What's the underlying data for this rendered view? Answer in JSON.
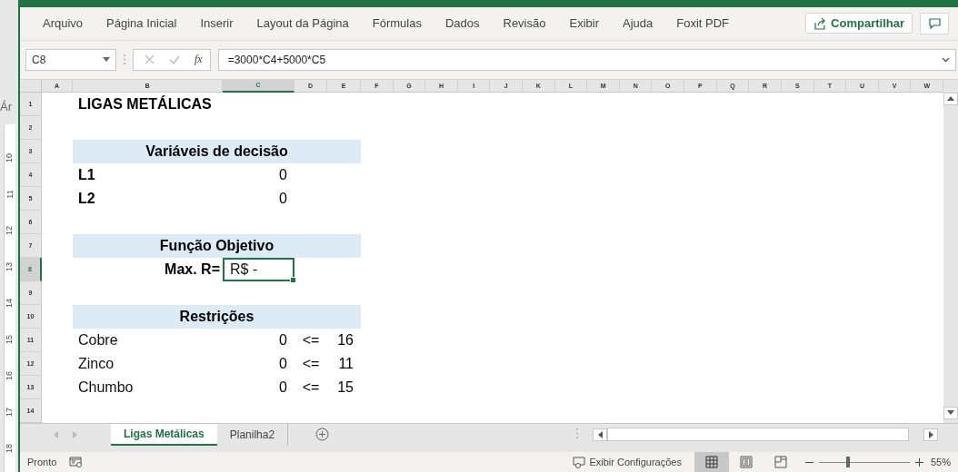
{
  "background_window": {
    "label": "Ár",
    "ruler_labels": [
      "10",
      "11",
      "12",
      "13",
      "14",
      "15",
      "16",
      "17",
      "18"
    ]
  },
  "menu": {
    "items": [
      {
        "label": "Arquivo"
      },
      {
        "label": "Página Inicial"
      },
      {
        "label": "Inserir"
      },
      {
        "label": "Layout da Página"
      },
      {
        "label": "Fórmulas"
      },
      {
        "label": "Dados"
      },
      {
        "label": "Revisão"
      },
      {
        "label": "Exibir"
      },
      {
        "label": "Ajuda"
      },
      {
        "label": "Foxit PDF"
      }
    ],
    "share_button": "Compartilhar"
  },
  "formula_bar": {
    "name_box": "C8",
    "function_label": "fx",
    "formula": "=3000*C4+5000*C5"
  },
  "columns": [
    {
      "label": "A",
      "selected": false
    },
    {
      "label": "B",
      "selected": false
    },
    {
      "label": "C",
      "selected": true
    },
    {
      "label": "D",
      "selected": false
    },
    {
      "label": "E",
      "selected": false
    },
    {
      "label": "F",
      "selected": false
    },
    {
      "label": "G",
      "selected": false
    },
    {
      "label": "H",
      "selected": false
    },
    {
      "label": "I",
      "selected": false
    },
    {
      "label": "J",
      "selected": false
    },
    {
      "label": "K",
      "selected": false
    },
    {
      "label": "L",
      "selected": false
    },
    {
      "label": "M",
      "selected": false
    },
    {
      "label": "N",
      "selected": false
    },
    {
      "label": "O",
      "selected": false
    },
    {
      "label": "P",
      "selected": false
    },
    {
      "label": "Q",
      "selected": false
    },
    {
      "label": "R",
      "selected": false
    },
    {
      "label": "S",
      "selected": false
    },
    {
      "label": "T",
      "selected": false
    },
    {
      "label": "U",
      "selected": false
    },
    {
      "label": "V",
      "selected": false
    },
    {
      "label": "W",
      "selected": false
    }
  ],
  "rows": [
    {
      "number": "1",
      "selected": false,
      "kind": "title",
      "text": "LIGAS METÁLICAS"
    },
    {
      "number": "2",
      "selected": false,
      "kind": "empty"
    },
    {
      "number": "3",
      "selected": false,
      "kind": "header",
      "text": "Variáveis de decisão"
    },
    {
      "number": "4",
      "selected": false,
      "kind": "variable",
      "name": "L1",
      "value": "0"
    },
    {
      "number": "5",
      "selected": false,
      "kind": "variable",
      "name": "L2",
      "value": "0"
    },
    {
      "number": "6",
      "selected": false,
      "kind": "empty"
    },
    {
      "number": "7",
      "selected": false,
      "kind": "header",
      "text": "Função Objetivo"
    },
    {
      "number": "8",
      "selected": true,
      "kind": "objective",
      "label": "Max. R=",
      "result": "R$ -",
      "result_selected": true
    },
    {
      "number": "9",
      "selected": false,
      "kind": "empty"
    },
    {
      "number": "10",
      "selected": false,
      "kind": "header",
      "text": "Restrições"
    },
    {
      "number": "11",
      "selected": false,
      "kind": "constraint",
      "name": "Cobre",
      "lhs": "0",
      "operator": "<=",
      "rhs": "16"
    },
    {
      "number": "12",
      "selected": false,
      "kind": "constraint",
      "name": "Zinco",
      "lhs": "0",
      "operator": "<=",
      "rhs": "11"
    },
    {
      "number": "13",
      "selected": false,
      "kind": "constraint",
      "name": "Chumbo",
      "lhs": "0",
      "operator": "<=",
      "rhs": "15"
    },
    {
      "number": "14",
      "selected": false,
      "kind": "empty"
    }
  ],
  "sheet_tabs": [
    {
      "label": "Ligas Metálicas",
      "selected": true
    },
    {
      "label": "Planilha2",
      "selected": false
    }
  ],
  "status_bar": {
    "status": "Pronto",
    "display_settings": "Exibir Configurações",
    "views": [
      {
        "kind": "normal",
        "selected": true
      },
      {
        "kind": "page-layout",
        "selected": false
      },
      {
        "kind": "page-break",
        "selected": false
      }
    ],
    "zoom": {
      "level": 0.3,
      "reading": "55%"
    }
  }
}
